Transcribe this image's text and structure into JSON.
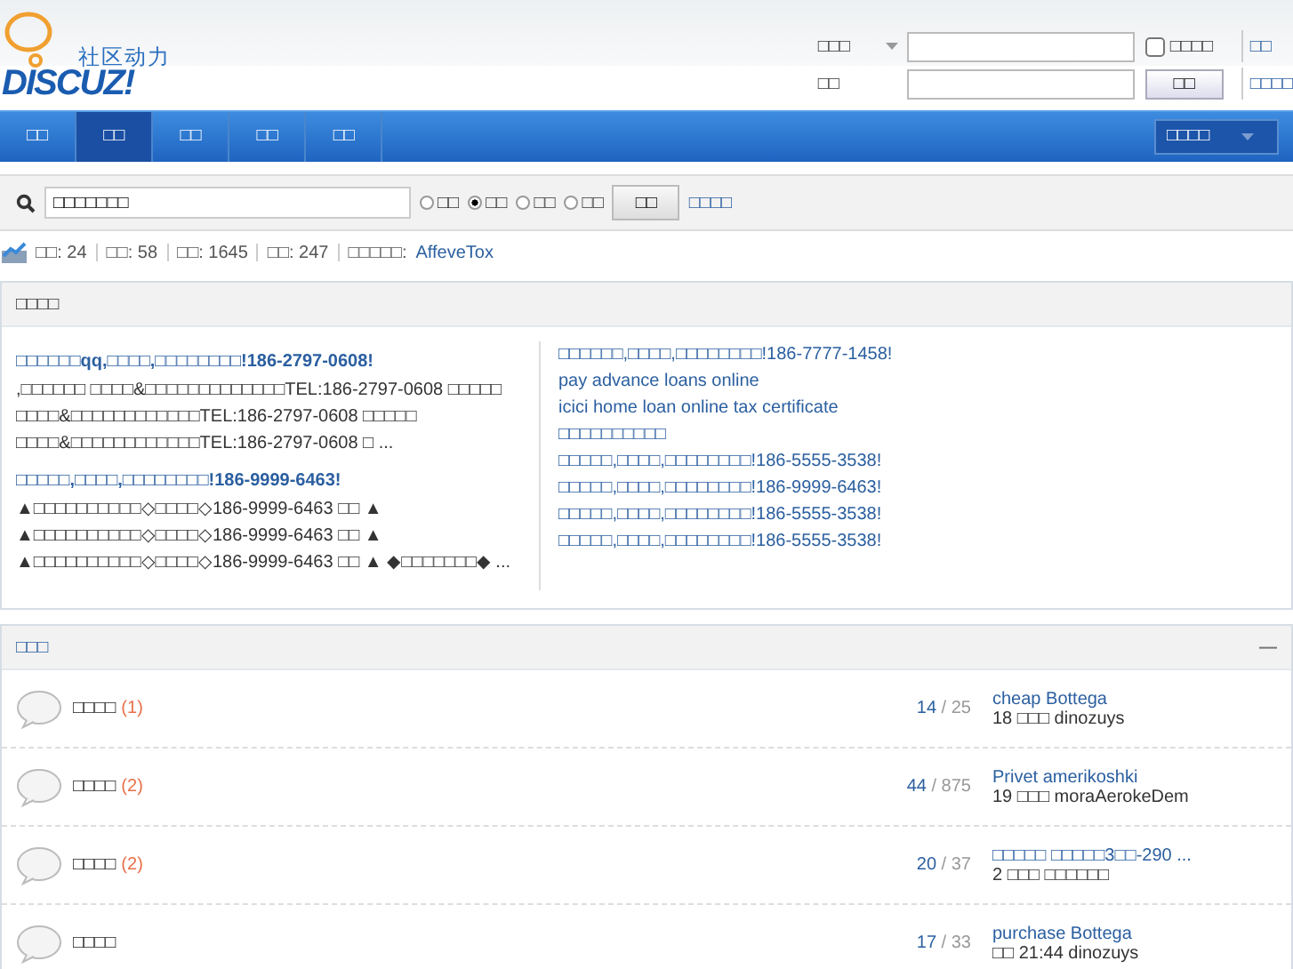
{
  "logo": {
    "tagline": "社区动力",
    "wordmark": "DISCUZ!"
  },
  "login": {
    "user_type": "□□□",
    "password_label": "□□",
    "remember": {
      "label": "□□□□",
      "checked": false
    },
    "login_button": "□□",
    "register_link": "□□",
    "forgot_link": "□□□□"
  },
  "nav": {
    "tabs": [
      {
        "label": "□□",
        "selected": false
      },
      {
        "label": "□□",
        "selected": true
      },
      {
        "label": "□□",
        "selected": false
      },
      {
        "label": "□□",
        "selected": false
      },
      {
        "label": "□□",
        "selected": false
      }
    ],
    "quick_menu": "□□□□"
  },
  "search": {
    "value": "□□□□□□□",
    "options": [
      {
        "label": "□□",
        "selected": false
      },
      {
        "label": "□□",
        "selected": true
      },
      {
        "label": "□□",
        "selected": false
      },
      {
        "label": "□□",
        "selected": false
      }
    ],
    "button": "□□",
    "advanced_link": "□□□□"
  },
  "stats": {
    "items": [
      {
        "label": "□□: 24"
      },
      {
        "label": "□□: 58"
      },
      {
        "label": "□□: 1645"
      },
      {
        "label": "□□: 247"
      }
    ],
    "newest_label": "□□□□□:",
    "newest_member": "AffeveTox"
  },
  "featured": {
    "title": "□□□□",
    "posts": [
      {
        "title": "□□□□□□qq,□□□□,□□□□□□□□!186-2797-0608!",
        "excerpt": ",□□□□□□ □□□□&□□□□□□□□□□□□□TEL:186-2797-0608 □□□□□ □□□□&□□□□□□□□□□□□TEL:186-2797-0608 □□□□□ □□□□&□□□□□□□□□□□□TEL:186-2797-0608 □ ..."
      },
      {
        "title": "□□□□□,□□□□,□□□□□□□□!186-9999-6463!",
        "excerpt": "▲□□□□□□□□□□◇□□□□◇186-9999-6463 □□ ▲ ▲□□□□□□□□□□◇□□□□◇186-9999-6463 □□ ▲ ▲□□□□□□□□□□◇□□□□◇186-9999-6463 □□ ▲ ◆□□□□□□□◆ ..."
      }
    ],
    "links": [
      "□□□□□□,□□□□,□□□□□□□□!186-7777-1458!",
      "pay advance loans online",
      "icici home loan online tax certificate",
      "□□□□□□□□□□",
      "□□□□□,□□□□,□□□□□□□□!186-5555-3538!",
      "□□□□□,□□□□,□□□□□□□□!186-9999-6463!",
      "□□□□□,□□□□,□□□□□□□□!186-5555-3538!",
      "□□□□□,□□□□,□□□□□□□□!186-5555-3538!"
    ]
  },
  "forums": {
    "title": "□□□",
    "collapse": "—",
    "rows": [
      {
        "name": "□□□□",
        "today": "(1)",
        "threads": "14",
        "posts": "/ 25",
        "last_title": "cheap Bottega",
        "last_meta": "18 □□□ dinozuys"
      },
      {
        "name": "□□□□",
        "today": "(2)",
        "threads": "44",
        "posts": "/ 875",
        "last_title": "Privet amerikoshki",
        "last_meta": "19 □□□ moraAerokeDem"
      },
      {
        "name": "□□□□",
        "today": "(2)",
        "threads": "20",
        "posts": "/ 37",
        "last_title": "□□□□□ □□□□□3□□-290 ...",
        "last_meta": "2 □□□ □□□□□□"
      },
      {
        "name": "□□□□",
        "threads": "17",
        "posts": "/ 33",
        "last_title": "purchase Bottega",
        "last_meta": "□□ 21:44 dinozuys"
      }
    ]
  }
}
